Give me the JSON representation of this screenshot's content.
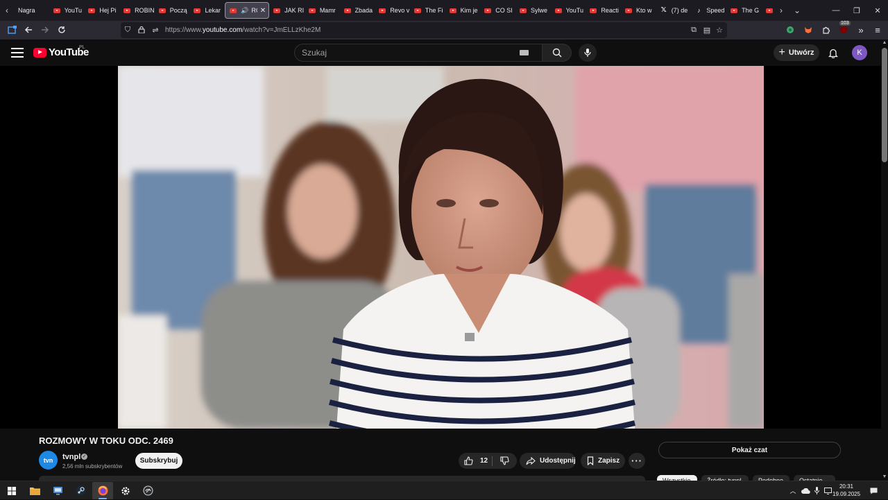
{
  "browser": {
    "tabs": [
      {
        "title": "Nagra",
        "icon": "none"
      },
      {
        "title": "YouTu",
        "icon": "youtube"
      },
      {
        "title": "Hej Pi",
        "icon": "youtube"
      },
      {
        "title": "ROBIN",
        "icon": "youtube"
      },
      {
        "title": "Począ",
        "icon": "youtube"
      },
      {
        "title": "Lekar",
        "icon": "youtube"
      },
      {
        "title": "RO",
        "icon": "youtube",
        "active": true
      },
      {
        "title": "JAK RI",
        "icon": "youtube"
      },
      {
        "title": "Mamr",
        "icon": "youtube"
      },
      {
        "title": "Zbada",
        "icon": "youtube"
      },
      {
        "title": "Revo v",
        "icon": "youtube"
      },
      {
        "title": "The Fi",
        "icon": "youtube"
      },
      {
        "title": "Kim je",
        "icon": "youtube"
      },
      {
        "title": "CO SI",
        "icon": "youtube"
      },
      {
        "title": "Sylwe",
        "icon": "youtube"
      },
      {
        "title": "YouTu",
        "icon": "youtube"
      },
      {
        "title": "Reacti",
        "icon": "youtube"
      },
      {
        "title": "Kto w",
        "icon": "youtube"
      },
      {
        "title": "(7) de",
        "icon": "x"
      },
      {
        "title": "Speed",
        "icon": "tiktok"
      },
      {
        "title": "The G",
        "icon": "youtube"
      },
      {
        "title": "",
        "icon": "youtube"
      }
    ],
    "url_prefix": "https://www.",
    "url_domain": "youtube.com",
    "url_path": "/watch?v=JmELLzKhe2M",
    "extension_badge": "103"
  },
  "youtube": {
    "logo_text": "YouTube",
    "country_code": "PL",
    "search_placeholder": "Szukaj",
    "create_label": "Utwórz",
    "avatar_letter": "K"
  },
  "video": {
    "title": "ROZMOWY W TOKU ODC. 2469",
    "channel_avatar_text": "tvn",
    "channel_name": "tvnpl",
    "verified_mark": "✓",
    "subscribers": "2,56 mln subskrybentów",
    "subscribe_label": "Subskrybuj",
    "likes": "12",
    "share_label": "Udostępnij",
    "save_label": "Zapisz",
    "more_label": "···"
  },
  "sidebar": {
    "show_chat_label": "Pokaż czat",
    "chips": [
      "Wszystkie",
      "Źródło: tvnpl",
      "Podobne",
      "Ostatnio"
    ]
  },
  "taskbar": {
    "time": "20:31",
    "date": "19.09.2025"
  },
  "colors": {
    "youtube_red": "#ff0033",
    "page_bg": "#0f0f0f",
    "browser_chrome": "#1c1b22",
    "avatar_purple": "#7e57c2"
  }
}
